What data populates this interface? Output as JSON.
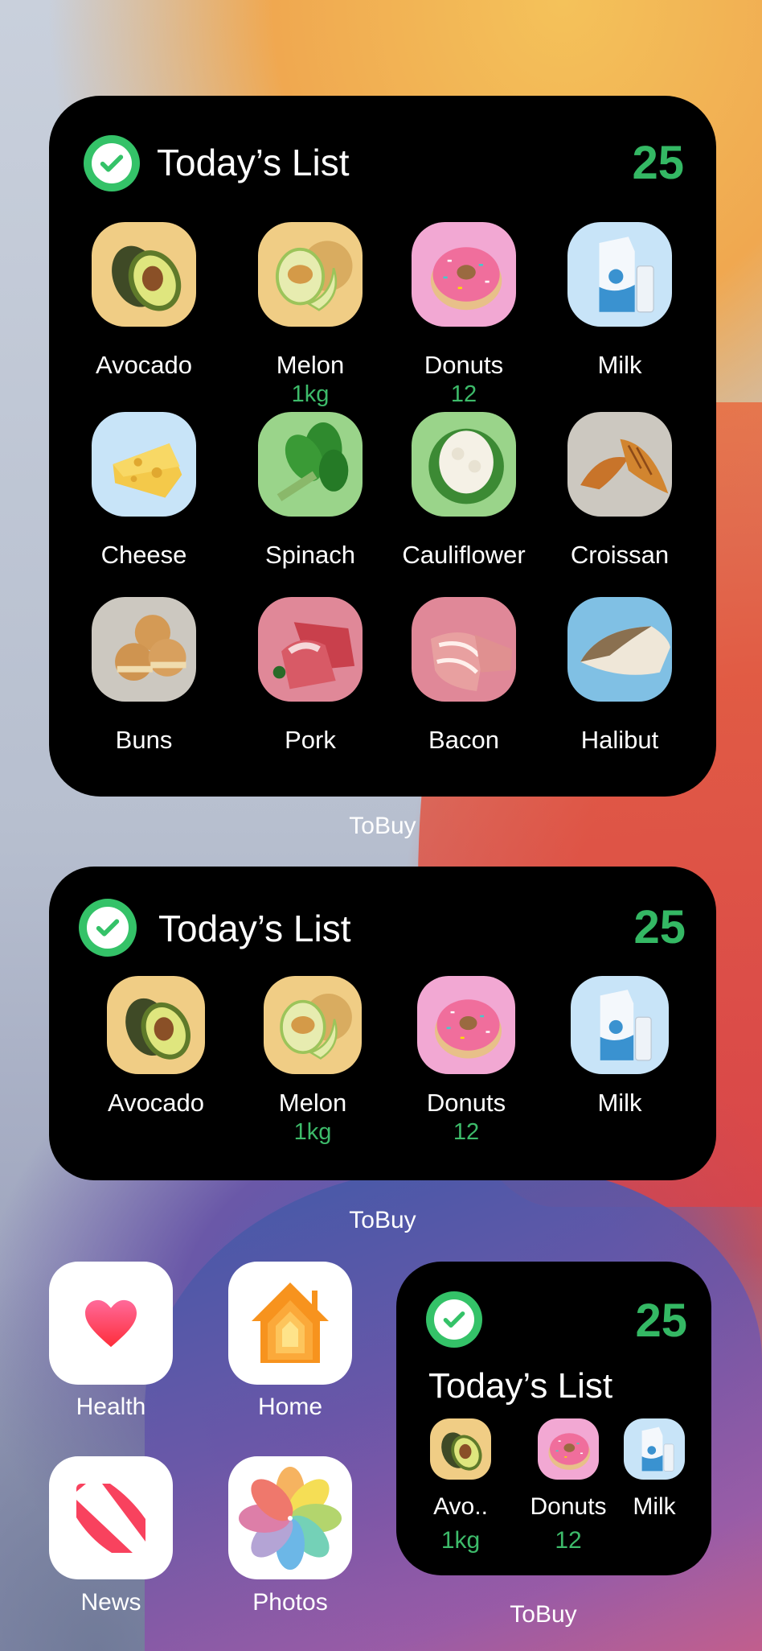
{
  "colors": {
    "accent_green": "#34c268",
    "quantity_green": "#3dbb6a",
    "widget_bg": "#000000"
  },
  "widget_large": {
    "title": "Today’s List",
    "count": "25",
    "app_label": "ToBuy",
    "icon": "checkmark-circle-icon",
    "items": [
      {
        "name": "Avocado",
        "qty": "",
        "food": "avocado",
        "bg": "#f0cd85"
      },
      {
        "name": "Melon",
        "qty": "1kg",
        "food": "melon",
        "bg": "#f0cd85"
      },
      {
        "name": "Donuts",
        "qty": "12",
        "food": "donut",
        "bg": "#f2a8d3"
      },
      {
        "name": "Milk",
        "qty": "",
        "food": "milk",
        "bg": "#c8e4f8"
      },
      {
        "name": "Cheese",
        "qty": "",
        "food": "cheese",
        "bg": "#c8e4f8"
      },
      {
        "name": "Spinach",
        "qty": "",
        "food": "spinach",
        "bg": "#9ad48a"
      },
      {
        "name": "Cauliflower",
        "qty": "",
        "food": "cauliflower",
        "bg": "#9ad48a"
      },
      {
        "name": "Croissan",
        "qty": "",
        "food": "croissant",
        "bg": "#ccc8c0"
      },
      {
        "name": "Buns",
        "qty": "",
        "food": "buns",
        "bg": "#ccc8c0"
      },
      {
        "name": "Pork",
        "qty": "",
        "food": "pork",
        "bg": "#e08898"
      },
      {
        "name": "Bacon",
        "qty": "",
        "food": "bacon",
        "bg": "#e08898"
      },
      {
        "name": "Halibut",
        "qty": "",
        "food": "halibut",
        "bg": "#80c0e4"
      }
    ]
  },
  "widget_medium": {
    "title": "Today’s List",
    "count": "25",
    "app_label": "ToBuy",
    "items": [
      {
        "name": "Avocado",
        "qty": "",
        "food": "avocado",
        "bg": "#f0cd85"
      },
      {
        "name": "Melon",
        "qty": "1kg",
        "food": "melon",
        "bg": "#f0cd85"
      },
      {
        "name": "Donuts",
        "qty": "12",
        "food": "donut",
        "bg": "#f2a8d3"
      },
      {
        "name": "Milk",
        "qty": "",
        "food": "milk",
        "bg": "#c8e4f8"
      }
    ]
  },
  "widget_small": {
    "title": "Today’s List",
    "count": "25",
    "app_label": "ToBuy",
    "items": [
      {
        "name": "Avo..",
        "qty": "1kg",
        "food": "avocado",
        "bg": "#f0cd85"
      },
      {
        "name": "Donuts",
        "qty": "12",
        "food": "donut",
        "bg": "#f2a8d3"
      },
      {
        "name": "Milk",
        "qty": "",
        "food": "milk",
        "bg": "#c8e4f8"
      }
    ]
  },
  "apps": [
    {
      "name": "Health",
      "icon": "heart-icon"
    },
    {
      "name": "Home",
      "icon": "house-icon"
    },
    {
      "name": "News",
      "icon": "news-icon"
    },
    {
      "name": "Photos",
      "icon": "photos-flower-icon"
    }
  ]
}
